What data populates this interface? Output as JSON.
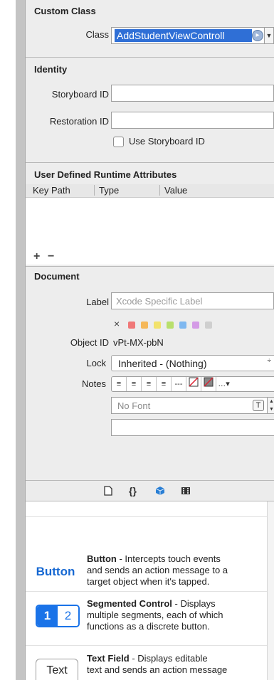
{
  "custom_class": {
    "title": "Custom Class",
    "class_label": "Class",
    "class_value": "AddStudentViewControll"
  },
  "identity": {
    "title": "Identity",
    "storyboard_id_label": "Storyboard ID",
    "storyboard_id_value": "",
    "restoration_id_label": "Restoration ID",
    "restoration_id_value": "",
    "use_storyboard_id_label": "Use Storyboard ID",
    "use_storyboard_id_checked": false
  },
  "runtime_attributes": {
    "title": "User Defined Runtime Attributes",
    "columns": [
      "Key Path",
      "Type",
      "Value"
    ],
    "add_label": "+",
    "remove_label": "−"
  },
  "document": {
    "title": "Document",
    "label_label": "Label",
    "label_placeholder": "Xcode Specific Label",
    "clear_label": "×",
    "label_colors": [
      "#f07878",
      "#f5b85a",
      "#f2e26b",
      "#b8df6c",
      "#7fb8f0",
      "#d49be6",
      "#cfcfcf"
    ],
    "object_id_label": "Object ID",
    "object_id_value": "vPt-MX-pbN",
    "lock_label": "Lock",
    "lock_value": "Inherited - (Nothing)",
    "lock_arrows": "÷",
    "notes_label": "Notes",
    "notes_font_placeholder": "No Font",
    "font_button": "T"
  },
  "library_tabs": {
    "file_icon": "file-template-icon",
    "code_icon": "code-snippet-icon",
    "object_icon": "object-library-icon",
    "media_icon": "media-library-icon"
  },
  "library_items": [
    {
      "icon_label": "Button",
      "name": "Button",
      "desc_line1": " - Intercepts touch events",
      "desc_line2": "and sends an action message to a",
      "desc_line3": "target object when it's tapped."
    },
    {
      "icon_label_a": "1",
      "icon_label_b": "2",
      "name": "Segmented Control",
      "desc_line1": " - Displays",
      "desc_line2": "multiple segments, each of which",
      "desc_line3": "functions as a discrete button."
    },
    {
      "icon_label": "Text",
      "name": "Text Field",
      "desc_line1": " - Displays editable",
      "desc_line2": "text and sends an action message"
    }
  ]
}
